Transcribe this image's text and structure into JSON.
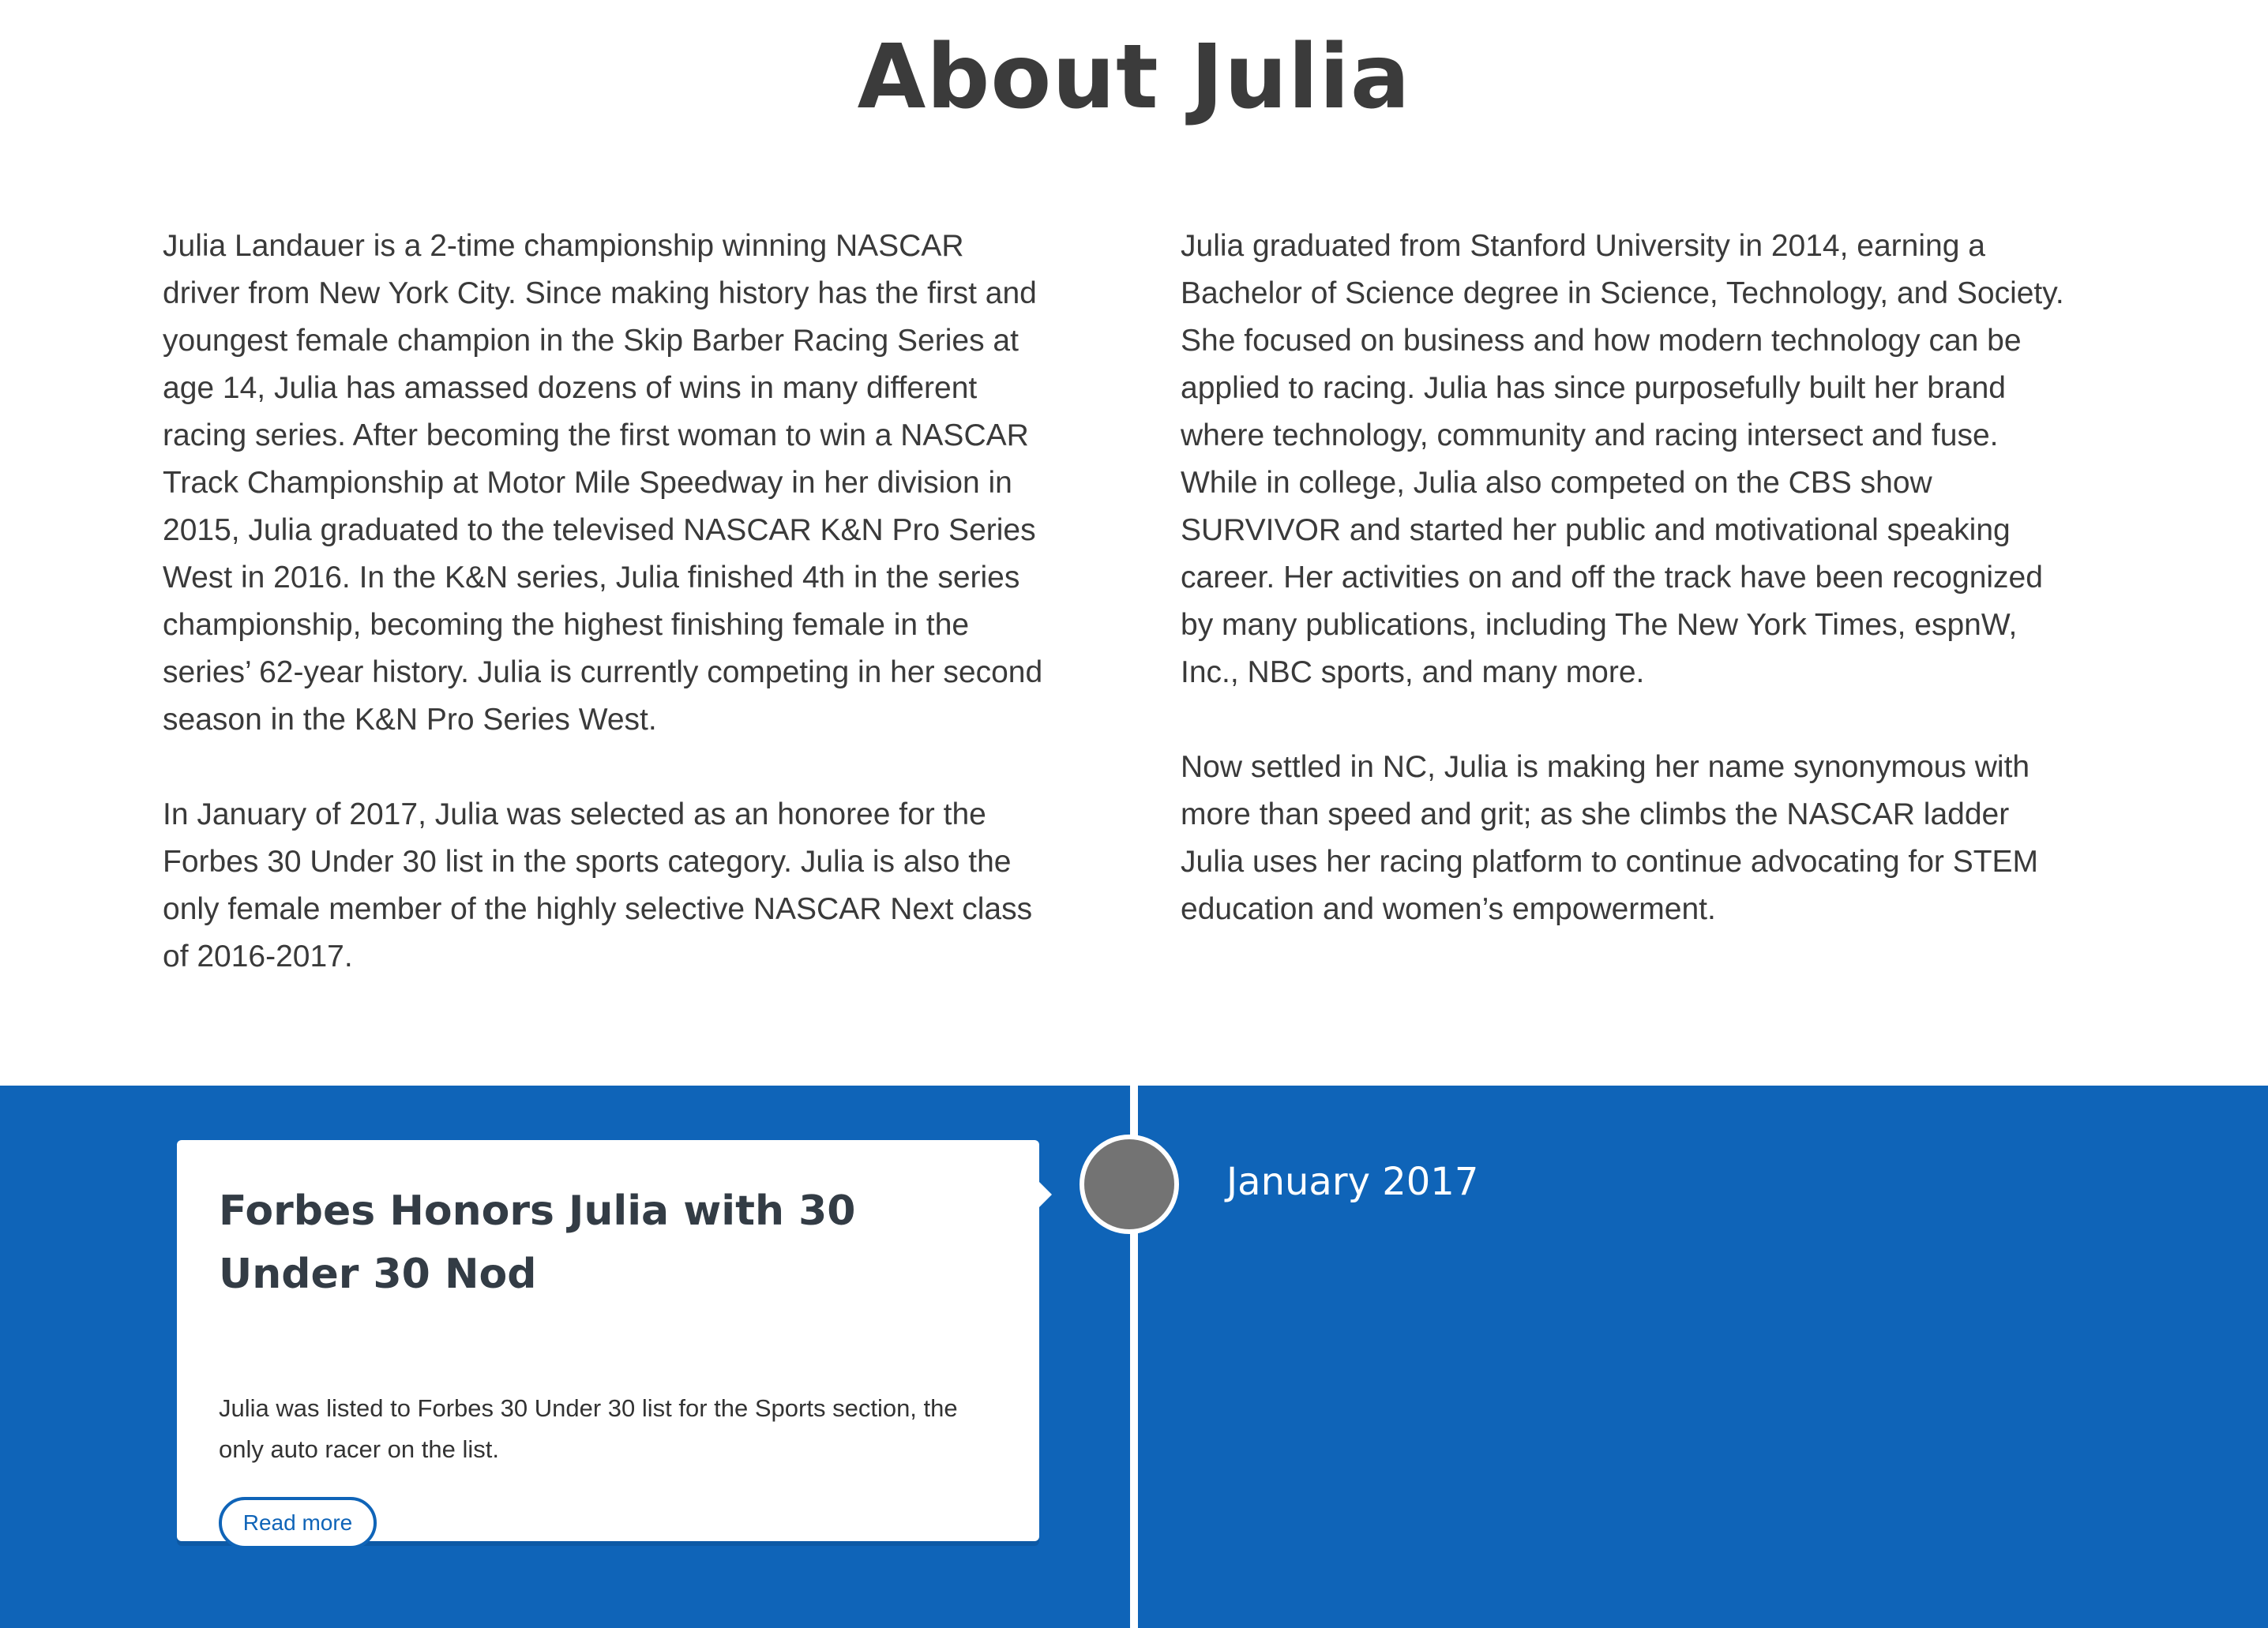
{
  "about": {
    "title": "About Julia",
    "left_paragraphs": [
      "Julia Landauer is a 2-time championship winning NASCAR driver from New York City. Since making history has the first and youngest female champion in the Skip Barber Racing Series at age 14, Julia has amassed dozens of wins in many different racing series. After becoming the first woman to win a NASCAR Track Championship at Motor Mile Speedway in her division in 2015, Julia graduated to the televised NASCAR K&N Pro Series West in 2016. In the K&N series, Julia finished 4th in the series championship, becoming the highest finishing female in the series’ 62-year history. Julia is currently competing in her second season in the K&N Pro Series West.",
      "In January of 2017, Julia was selected as an honoree for the Forbes 30 Under 30 list in the sports category. Julia is also the only female member of the highly selective NASCAR Next class of 2016-2017."
    ],
    "right_paragraphs": [
      "Julia graduated from Stanford University in 2014, earning a Bachelor of Science degree in Science, Technology, and Society. She focused on business and how modern technology can be applied to racing. Julia has since purposefully built her brand where technology, community and racing intersect and fuse. While in college, Julia also competed on the CBS show SURVIVOR and started her public and motivational speaking career. Her activities on and off the track have been recognized by many publications, including The New York Times, espnW, Inc., NBC sports, and many more.",
      "Now settled in NC, Julia is making her name synonymous with more than speed and grit; as she climbs the NASCAR ladder Julia uses her racing platform to continue advocating for STEM education and women’s empowerment."
    ]
  },
  "timeline": {
    "background_color": "#0f64b8",
    "node_color": "#737373",
    "entry": {
      "title": "Forbes Honors Julia with 30 Under 30 Nod",
      "text": "Julia was listed to Forbes 30 Under 30 list for the Sports section, the only auto racer on the list.",
      "read_more_label": "Read more",
      "date": "January 2017"
    }
  }
}
